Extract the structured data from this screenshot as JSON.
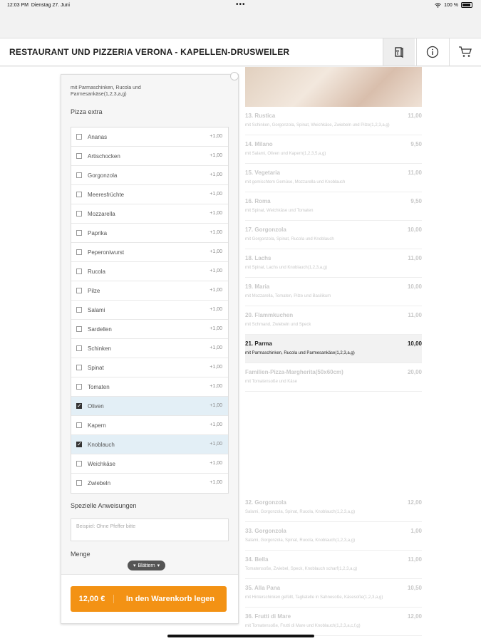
{
  "status_bar": {
    "time": "12:03 PM",
    "date": "Dienstag 27. Juni",
    "battery": "100 %",
    "dots": "•••"
  },
  "header": {
    "title": "RESTAURANT UND PIZZERIA VERONA - KAPELLEN-DRUSWEILER"
  },
  "menu": {
    "items": [
      {
        "name": "13. Rustica",
        "price": "11,00",
        "desc": "mit Schinken, Gorgonzola, Spinat, Weichkäse, Zwiebeln und Pilze(1,2,3,a,g)"
      },
      {
        "name": "14. Milano",
        "price": "9,50",
        "desc": "mit Salami, Oliven und Kapern(1,2,3,5,a,g)"
      },
      {
        "name": "15. Vegetaria",
        "price": "11,00",
        "desc": "mit gemischtem Gemüse, Mozzarella und Knoblauch"
      },
      {
        "name": "16. Roma",
        "price": "9,50",
        "desc": "mit Spinat, Weichkäse und Tomaten"
      },
      {
        "name": "17. Gorgonzola",
        "price": "10,00",
        "desc": "mit Gorgonzola, Spinat, Rucola und Knoblauch"
      },
      {
        "name": "18. Lachs",
        "price": "11,00",
        "desc": "mit Spinat, Lachs und Knoblauch(1,2,3,a,g)"
      },
      {
        "name": "19. Maria",
        "price": "10,00",
        "desc": "mit Mozzarella, Tomaten, Pilze und Basilikum"
      },
      {
        "name": "20. Flammkuchen",
        "price": "11,00",
        "desc": "mit Schmand, Zwiebeln und Speck"
      },
      {
        "name": "21. Parma",
        "price": "10,00",
        "desc": "mit Parmaschinken, Rucola und Parmesankäse(1,2,3,a,g)",
        "active": true
      },
      {
        "name": "Familien-Pizza-Margherita(50x60cm)",
        "price": "20,00",
        "desc": "mit Tomatensoße und Käse"
      }
    ],
    "lower_items": [
      {
        "name": "32. Gorgonzola",
        "price": "12,00",
        "desc": "Salami, Gorgonzola, Spinat, Rucola, Knoblauch(1,2,3,a,g)"
      },
      {
        "name": "33. Gorgonzola",
        "price": "1,00",
        "desc": "Salami, Gorgonzola, Spinat, Rucola, Knoblauch(1,2,3,a,g)"
      },
      {
        "name": "34. Bella",
        "price": "11,00",
        "desc": "Tomatensoße, Zwiebel, Speck, Knoblauch scharf(1,2,3,a,g)"
      },
      {
        "name": "35. Alla Pana",
        "price": "10,50",
        "desc": "mit Hinterschinken gefüllt, Tagliatelle in Sahnesoße, Käsesoße(1,2,3,a,g)"
      },
      {
        "name": "36. Frutti di Mare",
        "price": "12,00",
        "desc": "mit Tomatensoße, Frutti di Mare und Knoblauch(1,2,3,a,c,f,g)"
      }
    ]
  },
  "panel": {
    "description": "mit Parmaschinken, Rucola und Parmesankäse(1,2,3,a,g)",
    "extras_title": "Pizza extra",
    "options": [
      {
        "label": "Ananas",
        "price": "+1,00",
        "checked": false
      },
      {
        "label": "Artischocken",
        "price": "+1,00",
        "checked": false
      },
      {
        "label": "Gorgonzola",
        "price": "+1,00",
        "checked": false
      },
      {
        "label": "Meeresfrüchte",
        "price": "+1,00",
        "checked": false
      },
      {
        "label": "Mozzarella",
        "price": "+1,00",
        "checked": false
      },
      {
        "label": "Paprika",
        "price": "+1,00",
        "checked": false
      },
      {
        "label": "Peperoniwurst",
        "price": "+1,00",
        "checked": false
      },
      {
        "label": "Rucola",
        "price": "+1,00",
        "checked": false
      },
      {
        "label": "Pilze",
        "price": "+1,00",
        "checked": false
      },
      {
        "label": "Salami",
        "price": "+1,00",
        "checked": false
      },
      {
        "label": "Sardellen",
        "price": "+1,00",
        "checked": false
      },
      {
        "label": "Schinken",
        "price": "+1,00",
        "checked": false
      },
      {
        "label": "Spinat",
        "price": "+1,00",
        "checked": false
      },
      {
        "label": "Tomaten",
        "price": "+1,00",
        "checked": false
      },
      {
        "label": "Oliven",
        "price": "+1,00",
        "checked": true
      },
      {
        "label": "Kapern",
        "price": "+1,00",
        "checked": false
      },
      {
        "label": "Knoblauch",
        "price": "+1,00",
        "checked": true
      },
      {
        "label": "Weichkäse",
        "price": "+1,00",
        "checked": false
      },
      {
        "label": "Zwiebeln",
        "price": "+1,00",
        "checked": false
      }
    ],
    "instructions_title": "Spezielle Anweisungen",
    "instructions_placeholder": "Beispiel: Ohne Pfeffer bitte",
    "quantity_title": "Menge",
    "scroll_hint": "Blättern",
    "cart_price": "12,00 €",
    "cart_label": "In den Warenkorb legen"
  }
}
